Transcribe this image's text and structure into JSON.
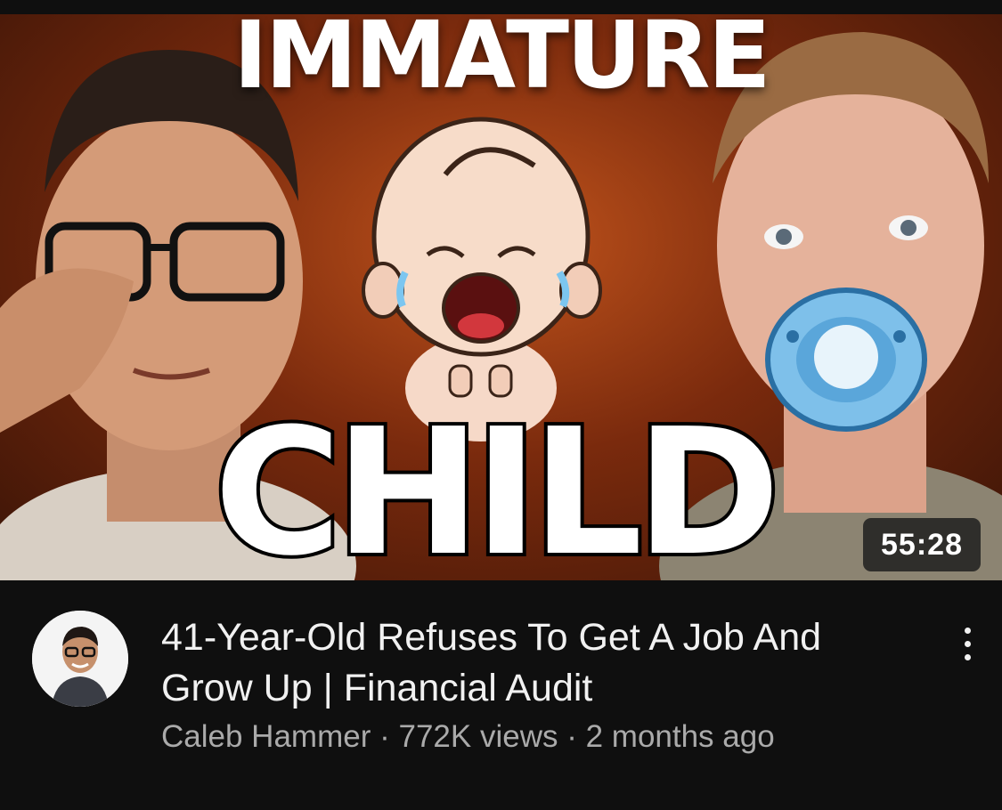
{
  "thumbnail": {
    "overlay_top_text": "IMMATURE",
    "overlay_main_text": "CHILD",
    "duration": "55:28"
  },
  "video": {
    "title": "41-Year-Old Refuses To Get A Job And Grow Up | Financial Audit",
    "channel": "Caleb Hammer",
    "separator": "·",
    "views": "772K views",
    "age": "2 months ago"
  },
  "icons": {
    "more": "more-vert-icon",
    "avatar": "channel-avatar"
  },
  "colors": {
    "background": "#0f0f0f",
    "title_text": "#f1f1f1",
    "secondary_text": "#aaaaaa",
    "duration_badge_bg": "#1e1e1e"
  }
}
